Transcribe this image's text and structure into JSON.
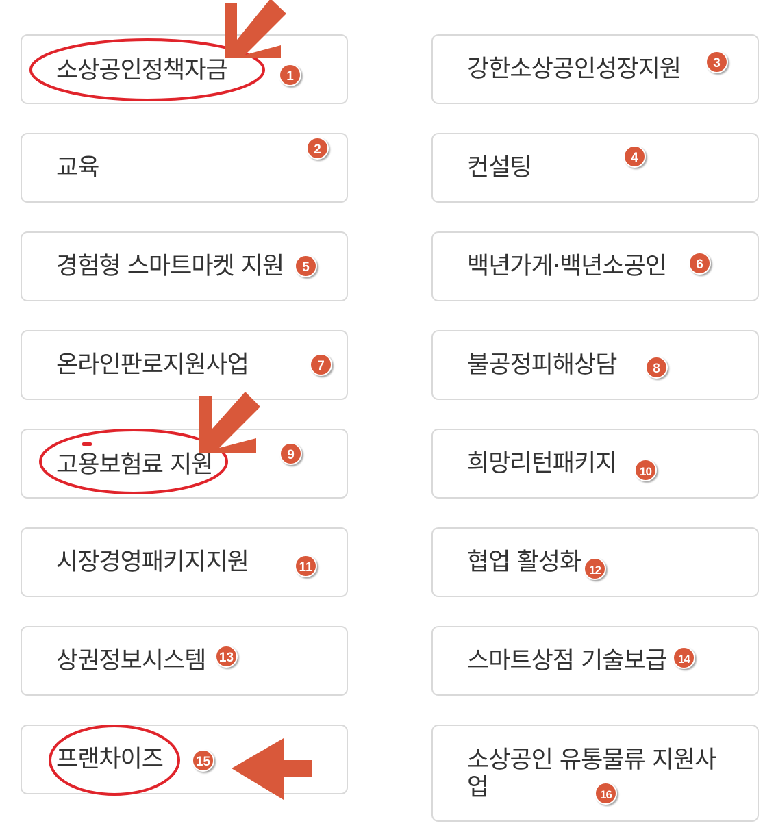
{
  "colors": {
    "badge": "#d9583a",
    "annotation_circle": "#e0242b",
    "annotation_arrow": "#d9583a",
    "card_border": "#d9d9d9",
    "label_text": "#333333"
  },
  "menu": {
    "items": [
      {
        "label": "소상공인정책자금",
        "badge": "1"
      },
      {
        "label": "교육",
        "badge": "2"
      },
      {
        "label": "강한소상공인성장지원",
        "badge": "3"
      },
      {
        "label": "컨설팅",
        "badge": "4"
      },
      {
        "label": "경험형 스마트마켓 지원",
        "badge": "5"
      },
      {
        "label": "백년가게·백년소공인",
        "badge": "6"
      },
      {
        "label": "온라인판로지원사업",
        "badge": "7"
      },
      {
        "label": "불공정피해상담",
        "badge": "8"
      },
      {
        "label": "고용보험료 지원",
        "badge": "9"
      },
      {
        "label": "희망리턴패키지",
        "badge": "10"
      },
      {
        "label": "시장경영패키지지원",
        "badge": "11"
      },
      {
        "label": "협업 활성화",
        "badge": "12"
      },
      {
        "label": "상권정보시스템",
        "badge": "13"
      },
      {
        "label": "스마트상점 기술보급",
        "badge": "14"
      },
      {
        "label": "프랜차이즈",
        "badge": "15"
      },
      {
        "label": "소상공인 유통물류 지원사업",
        "badge": "16"
      }
    ]
  },
  "annotations": {
    "circled_items": [
      "소상공인정책자금",
      "고용보험료 지원",
      "프랜차이즈"
    ],
    "arrow_icons": [
      "arrow-down-left-icon",
      "arrow-down-left-icon",
      "arrow-left-icon"
    ]
  }
}
